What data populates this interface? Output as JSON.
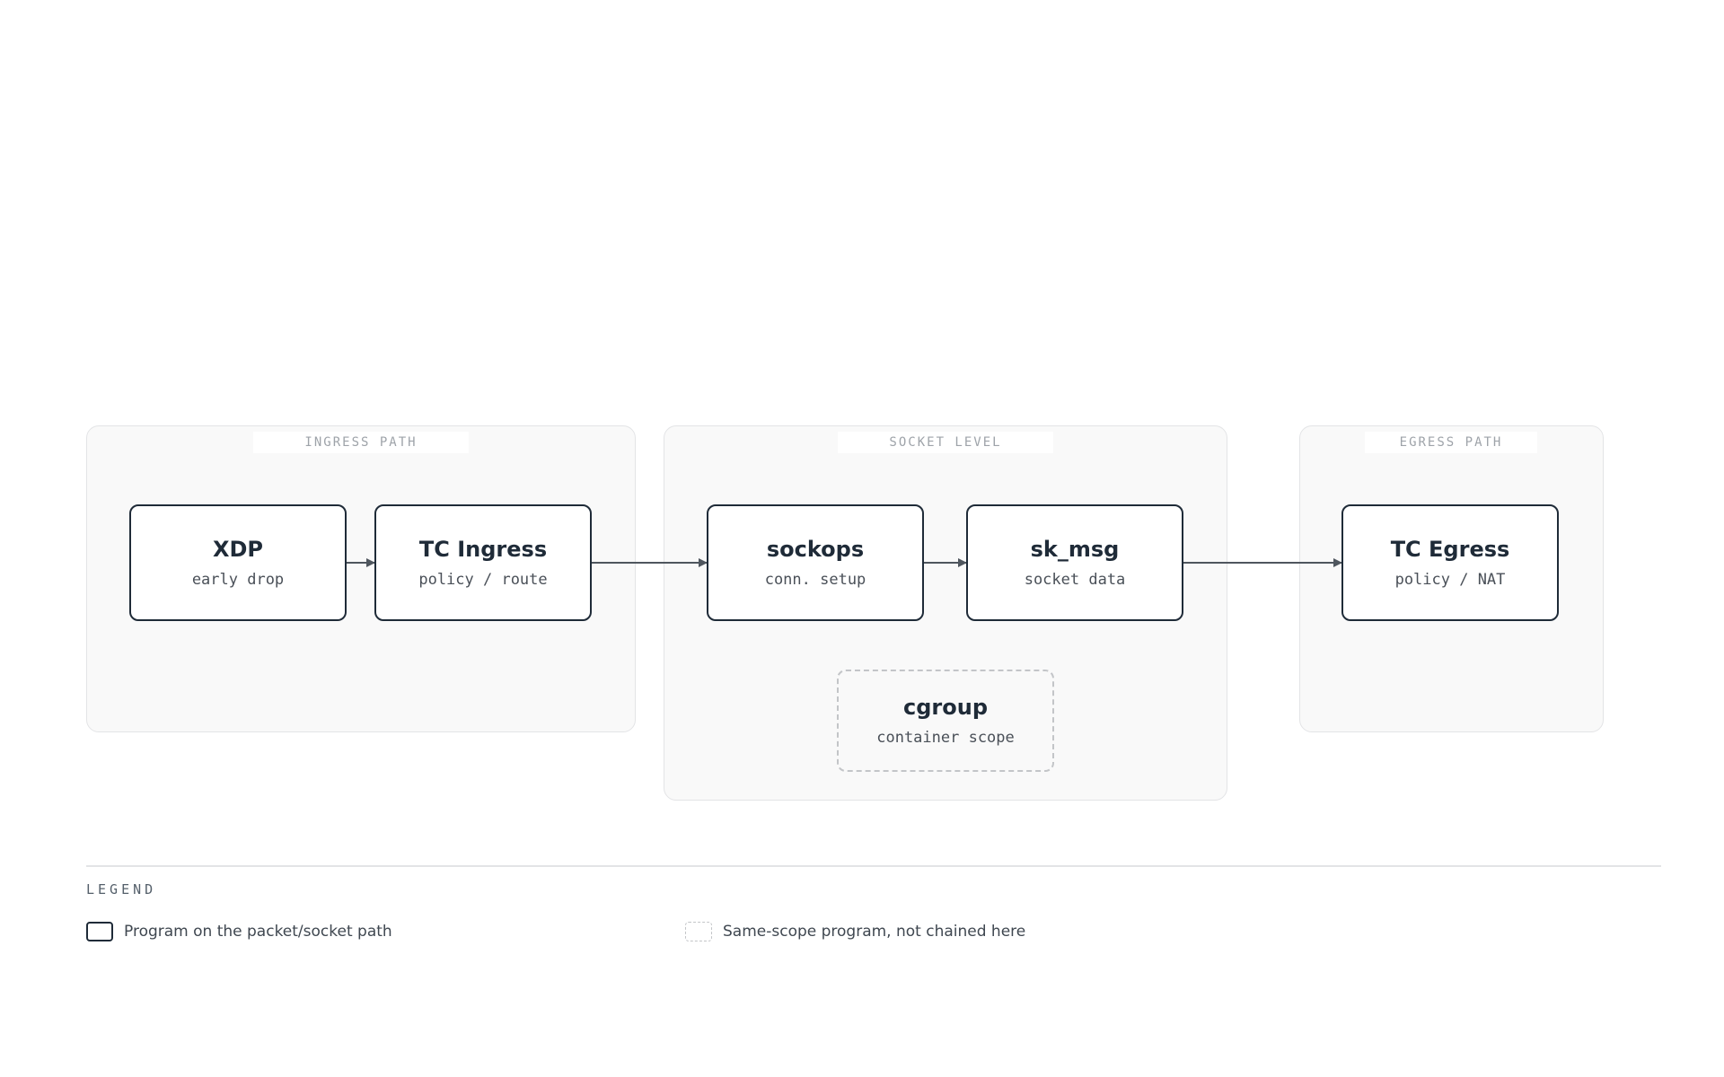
{
  "groups": {
    "ingress": {
      "label": "INGRESS PATH"
    },
    "socket": {
      "label": "SOCKET LEVEL"
    },
    "egress": {
      "label": "EGRESS PATH"
    }
  },
  "nodes": {
    "xdp": {
      "title": "XDP",
      "subtitle": "early drop"
    },
    "tc_ingress": {
      "title": "TC Ingress",
      "subtitle": "policy / route"
    },
    "sockops": {
      "title": "sockops",
      "subtitle": "conn. setup"
    },
    "sk_msg": {
      "title": "sk_msg",
      "subtitle": "socket data"
    },
    "tc_egress": {
      "title": "TC Egress",
      "subtitle": "policy / NAT"
    },
    "cgroup": {
      "title": "cgroup",
      "subtitle": "container scope"
    }
  },
  "edges": [
    {
      "from": "xdp",
      "to": "tc_ingress"
    },
    {
      "from": "tc_ingress",
      "to": "sockops"
    },
    {
      "from": "sockops",
      "to": "sk_msg"
    },
    {
      "from": "sk_msg",
      "to": "tc_egress"
    }
  ],
  "legend": {
    "title": "LEGEND",
    "items": [
      {
        "style": "solid",
        "label": "Program on the packet/socket path"
      },
      {
        "style": "dashed",
        "label": "Same-scope program, not chained here"
      }
    ]
  },
  "colors": {
    "node_border": "#1f2b38",
    "edge": "#4f565e",
    "group_fill": "#f9f9f9",
    "dashed_border": "#c3c5c8"
  }
}
